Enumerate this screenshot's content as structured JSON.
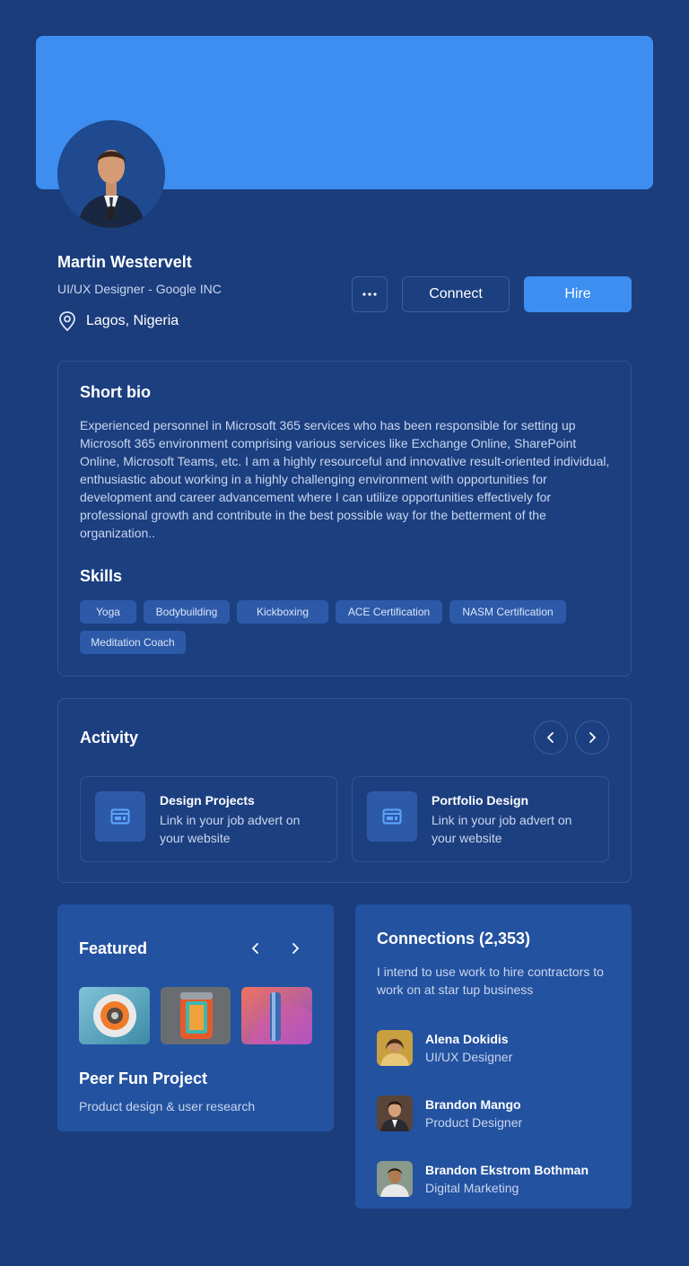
{
  "profile": {
    "name": "Martin Westervelt",
    "title": "UI/UX Designer - Google INC",
    "location": "Lagos, Nigeria"
  },
  "actions": {
    "connect_label": "Connect",
    "hire_label": "Hire",
    "more_icon": "more-dots-icon"
  },
  "bio": {
    "heading": "Short bio",
    "text": "Experienced personnel in Microsoft 365 services who has been responsible for setting up Microsoft 365 environment comprising various services like Exchange Online, SharePoint Online, Microsoft Teams, etc. I am a highly resourceful and innovative result-oriented individual, enthusiastic about working in a highly challenging environment with opportunities for development and career advancement where I can utilize opportunities effectively for professional growth and contribute in the best possible way for the betterment of the organization.."
  },
  "skills": {
    "heading": "Skills",
    "items": [
      "Yoga",
      "Bodybuilding",
      "Kickboxing",
      "ACE Certification",
      "NASM Certification",
      "Meditation Coach"
    ]
  },
  "activity": {
    "heading": "Activity",
    "items": [
      {
        "title": "Design Projects",
        "desc": "Link in your job advert on your website",
        "icon": "browser-window-icon"
      },
      {
        "title": "Portfolio Design",
        "desc": "Link in your job advert on your website",
        "icon": "browser-window-icon"
      }
    ]
  },
  "featured": {
    "heading": "Featured",
    "project_title": "Peer Fun Project",
    "project_sub": "Product design & user research"
  },
  "connections": {
    "heading": "Connections (2,353)",
    "desc": "I intend to use work to hire contractors to work on at star tup business",
    "people": [
      {
        "name": "Alena Dokidis",
        "role": "UI/UX Designer"
      },
      {
        "name": "Brandon Mango",
        "role": "Product Designer"
      },
      {
        "name": "Brandon Ekstrom Bothman",
        "role": "Digital Marketing"
      }
    ]
  },
  "colors": {
    "background": "#1b3d7c",
    "accent": "#3d8ef0",
    "card": "#1c3f80",
    "card_alt": "#2352a0",
    "chip": "#2d5aa8"
  }
}
